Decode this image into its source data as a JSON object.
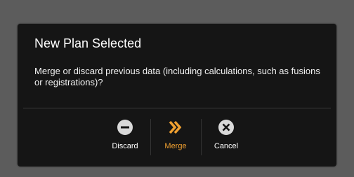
{
  "dialog": {
    "title": "New Plan Selected",
    "message": "Merge or discard previous data (including calculations, such as fusions or registrations)?",
    "buttons": {
      "discard": {
        "label": "Discard",
        "icon": "minus-circle-icon"
      },
      "merge": {
        "label": "Merge",
        "icon": "double-chevron-right-icon"
      },
      "cancel": {
        "label": "Cancel",
        "icon": "close-circle-icon"
      }
    },
    "colors": {
      "background": "#151515",
      "accent": "#f0a030",
      "text": "#ffffff"
    }
  }
}
